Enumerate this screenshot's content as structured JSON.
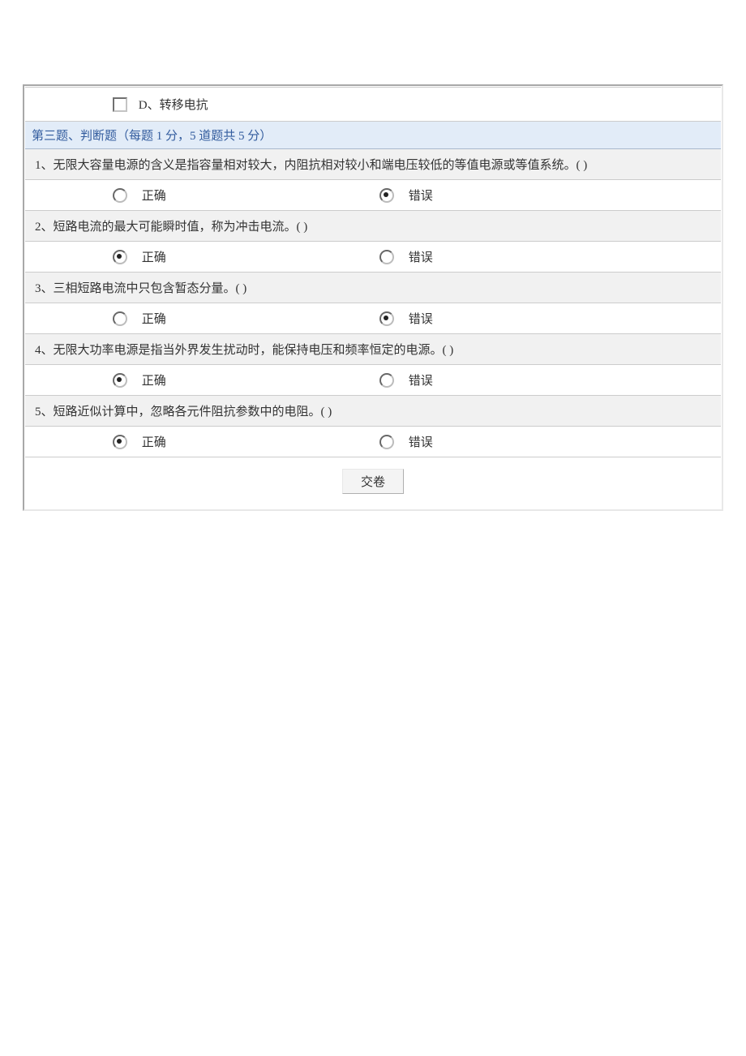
{
  "top_option": {
    "letter": "D",
    "label": "转移电抗",
    "checked": false
  },
  "section_header": "第三题、判断题（每题 1 分，5 道题共 5 分）",
  "labels": {
    "true": "正确",
    "false": "错误"
  },
  "questions": [
    {
      "n": 1,
      "text": "无限大容量电源的含义是指容量相对较大，内阻抗相对较小和端电压较低的等值电源或等值系统。( )",
      "selected": "false"
    },
    {
      "n": 2,
      "text": "短路电流的最大可能瞬时值，称为冲击电流。( )",
      "selected": "true"
    },
    {
      "n": 3,
      "text": "三相短路电流中只包含暂态分量。( )",
      "selected": "false"
    },
    {
      "n": 4,
      "text": "无限大功率电源是指当外界发生扰动时，能保持电压和频率恒定的电源。( )",
      "selected": "true"
    },
    {
      "n": 5,
      "text": "短路近似计算中，忽略各元件阻抗参数中的电阻。( )",
      "selected": "true"
    }
  ],
  "submit_label": "交卷"
}
